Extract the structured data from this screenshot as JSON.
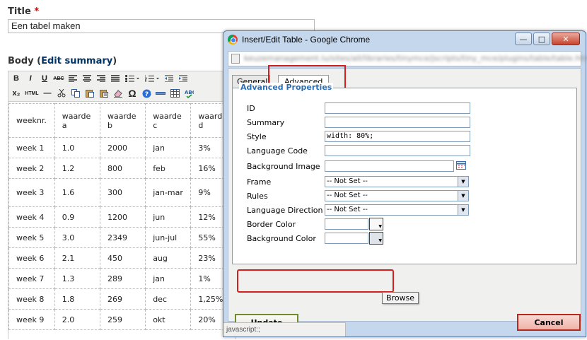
{
  "page": {
    "title_label": "Title",
    "required_mark": "*",
    "title_value": "Een tabel maken",
    "body_label": "Body",
    "body_edit_open": "(",
    "body_edit_link": "Edit summary",
    "body_edit_close": ")"
  },
  "editor": {
    "toolbar_row1": [
      "B",
      "I",
      "U",
      "ABC",
      "align-left-icon",
      "align-center-icon",
      "align-right-icon",
      "align-justify-icon",
      "bullet-list-icon",
      "numbered-list-icon",
      "outdent-icon",
      "indent-icon"
    ],
    "toolbar_row2": [
      "x₂",
      "HTML",
      "—",
      "cut-icon",
      "copy-icon",
      "paste-icon",
      "paste-text-icon",
      "eraser-icon",
      "Ω",
      "help-icon",
      "hr-icon",
      "table-icon",
      "spellcheck-icon"
    ],
    "table": [
      [
        "weeknr.",
        "waarde a",
        "waarde b",
        "waarde c",
        "waarde d"
      ],
      [
        "week 1",
        "1.0",
        "2000",
        "jan",
        "3%"
      ],
      [
        "week 2",
        "1.2",
        "800",
        "feb",
        "16%"
      ],
      [
        "week 3",
        "1.6",
        "300",
        "jan-mar",
        "9%"
      ],
      [
        "week 4",
        "0.9",
        "1200",
        "jun",
        "12%"
      ],
      [
        "week 5",
        "3.0",
        "2349",
        "jun-jul",
        "55%"
      ],
      [
        "week 6",
        "2.1",
        "450",
        "aug",
        "23%"
      ],
      [
        "week 7",
        "1.3",
        "289",
        "jan",
        "1%"
      ],
      [
        "week 8",
        "1.8",
        "269",
        "dec",
        "1,25%"
      ],
      [
        "week 9",
        "2.0",
        "259",
        "okt",
        "20%"
      ]
    ]
  },
  "dialog": {
    "title": "Insert/Edit Table - Google Chrome",
    "url": "keuzemanagement.lu/sites/all/libraries/tinymce/jscripts/tiny_mce/plugins/table/table.htm",
    "window_buttons": {
      "minimize": "—",
      "maximize": "□",
      "close": "✕"
    },
    "tabs": {
      "general": "General",
      "advanced": "Advanced"
    },
    "legend": "Advanced Properties",
    "fields": {
      "id": "ID",
      "summary": "Summary",
      "style": "Style",
      "style_value": "width: 80%;",
      "language_code": "Language Code",
      "background_image": "Background Image",
      "frame": "Frame",
      "frame_value": "-- Not Set --",
      "rules": "Rules",
      "rules_value": "-- Not Set --",
      "language_direction": "Language Direction",
      "language_direction_value": "-- Not Set --",
      "border_color": "Border Color",
      "background_color": "Background Color"
    },
    "tooltip": "Browse",
    "update_label": "Update",
    "cancel_label": "Cancel",
    "status": "javascript:;"
  },
  "colors": {
    "highlight": "#d12020",
    "legend": "#2b6fb6",
    "update_border": "#6f8b2b",
    "cancel_border": "#b52a1c",
    "link": "#036"
  }
}
